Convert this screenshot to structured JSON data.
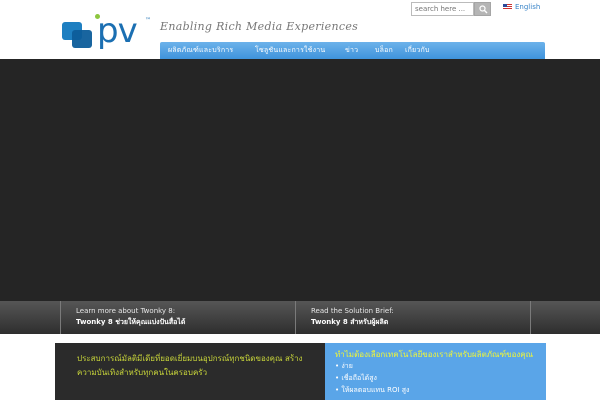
{
  "header": {
    "logo_text": "pv",
    "logo_tm": "™",
    "tagline": "Enabling Rich Media Experiences",
    "search_placeholder": "search here ...",
    "language": "English",
    "colors": {
      "brand_blue": "#1b6fb2",
      "logo_dot_green": "#8dc63f",
      "nav_blue": "#4a9ae0"
    }
  },
  "nav": {
    "items": [
      {
        "label": "ผลิตภัณฑ์และบริการ"
      },
      {
        "label": "โซลูชันและการใช้งาน"
      },
      {
        "label": "ข่าว"
      },
      {
        "label": "บล็อก"
      },
      {
        "label": "เกี่ยวกับ"
      }
    ]
  },
  "promo": {
    "left": {
      "line1": "Learn more about Twonky 8:",
      "line2": "Twonky 8 ช่วยให้คุณแบ่งปันสื่อได้"
    },
    "right": {
      "line1": "Read the Solution Brief:",
      "line2": "Twonky 8 สำหรับผู้ผลิต"
    }
  },
  "bottom": {
    "left_text": "ประสบการณ์มัลติมีเดียที่ยอดเยี่ยมบนอุปกรณ์ทุกชนิดของคุณ สร้างความบันเทิงสำหรับทุกคนในครอบครัว",
    "right_title": "ทำไมต้องเลือกเทคโนโลยีของเราสำหรับผลิตภัณฑ์ของคุณ",
    "right_items": [
      "ง่าย",
      "เชื่อถือได้สูง",
      "ให้ผลตอบแทน ROI สูง"
    ],
    "colors": {
      "left_text": "#c7d43a",
      "right_title": "#eef53a",
      "right_bg": "#5aa5e8"
    }
  }
}
